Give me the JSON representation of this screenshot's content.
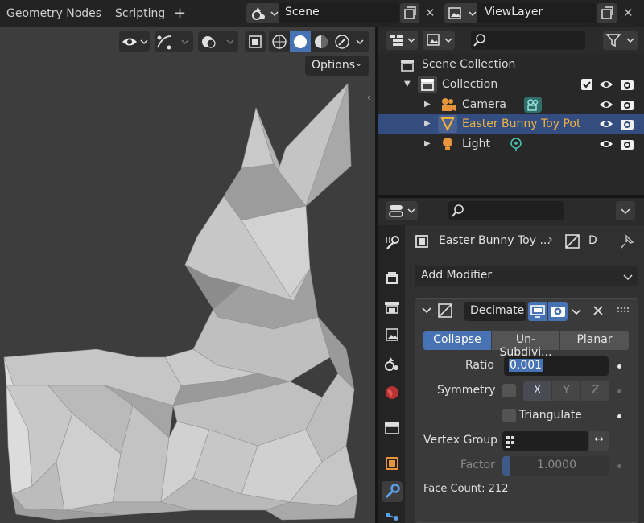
{
  "workspace_tabs": [
    "Geometry Nodes",
    "Scripting"
  ],
  "scene": {
    "name": "Scene"
  },
  "view_layer": {
    "name": "ViewLayer"
  },
  "viewport": {
    "options_label": "Options"
  },
  "outliner": {
    "scene_collection": "Scene Collection",
    "collection": "Collection",
    "objects": [
      {
        "name": "Camera",
        "color": "#d8d8d8"
      },
      {
        "name": "Easter Bunny Toy Pot",
        "color": "#f0b43c",
        "selected": true
      },
      {
        "name": "Light",
        "color": "#d8d8d8"
      }
    ]
  },
  "properties": {
    "object_name": "Easter Bunny Toy ...",
    "modifier_breadcrumb": "D",
    "add_modifier_label": "Add Modifier",
    "modifier": {
      "name": "Decimate",
      "modes": [
        "Collapse",
        "Un-Subdivi...",
        "Planar"
      ],
      "active_mode": "Collapse",
      "ratio_label": "Ratio",
      "ratio_value": "0.001",
      "symmetry_label": "Symmetry",
      "axes": [
        "X",
        "Y",
        "Z"
      ],
      "active_axis": "X",
      "triangulate_label": "Triangulate",
      "vertex_group_label": "Vertex Group",
      "factor_label": "Factor",
      "factor_value": "1.0000",
      "face_count": "Face Count: 212"
    }
  },
  "colors": {
    "accent": "#4772b3",
    "selected_row": "#334d80",
    "active_object": "#f0b43c"
  }
}
